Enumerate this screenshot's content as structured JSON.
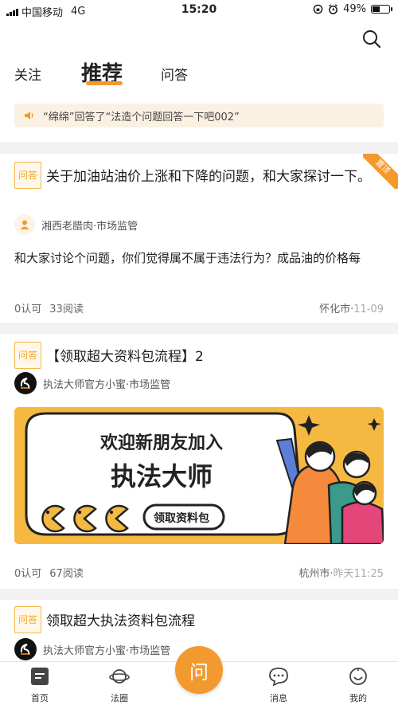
{
  "status_bar": {
    "carrier": "中国移动",
    "network": "4G",
    "time": "15:20",
    "battery": "49%",
    "battery_level": 0.49
  },
  "header": {
    "tabs": [
      {
        "label": "关注"
      },
      {
        "label": "推荐"
      },
      {
        "label": "问答"
      }
    ],
    "notice": "“绵绵”回答了“法造个问题回答一下吧002”"
  },
  "posts": [
    {
      "tag": "问答",
      "title": "关于加油站油价上涨和下降的问题，和大家探讨一下。",
      "pinned_label": "置顶",
      "author": "湘西老腊肉",
      "category": "·市场监管",
      "body": "和大家讨论个问题，你们觉得属不属于违法行为？成品油的价格每",
      "likes": "0认可",
      "reads": "33阅读",
      "location": "怀化市·",
      "date": "11-09"
    },
    {
      "tag": "问答",
      "title": "【领取超大资料包流程】2",
      "author": "执法大师官方小蜜",
      "category": "·市场监管",
      "banner": {
        "line1": "欢迎新朋友加入",
        "line2": "执法大师",
        "button": "领取资料包"
      },
      "likes": "0认可",
      "reads": "67阅读",
      "location": "杭州市·",
      "date": "昨天11:25"
    },
    {
      "tag": "问答",
      "title": "领取超大执法资料包流程",
      "author": "执法大师官方小蜜",
      "category": "·市场监管"
    }
  ],
  "bottom_nav": {
    "items": [
      {
        "label": "首页"
      },
      {
        "label": "法圈"
      },
      {
        "label": "消息"
      },
      {
        "label": "我的"
      }
    ],
    "center": "问"
  },
  "colors": {
    "accent": "#f39a2e",
    "notice_bg": "#fbf1e3",
    "tag": "#f5a623"
  }
}
